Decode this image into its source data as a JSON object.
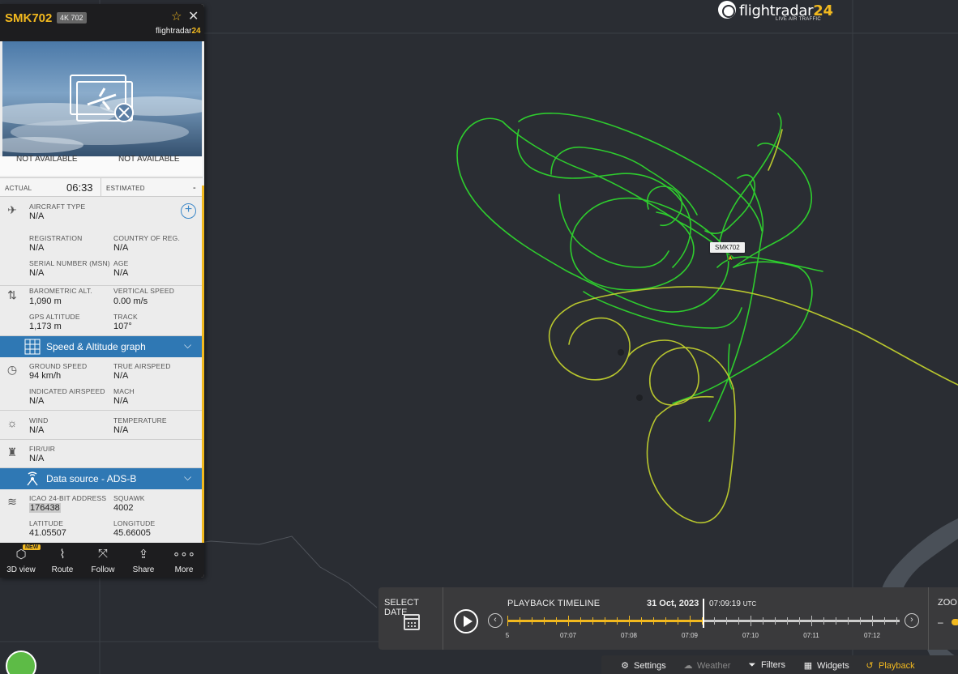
{
  "header": {
    "callsign": "SMK702",
    "registration_badge": "4K 702",
    "brand_prefix": "flightradar",
    "brand_suffix": "24"
  },
  "logo": {
    "name_prefix": "flightradar",
    "name_suffix": "24",
    "tagline": "LIVE AIR TRAFFIC"
  },
  "map": {
    "flight_label": "SMK702",
    "track_colors": {
      "high": "#2ecc2e",
      "low": "#b8c62e"
    }
  },
  "times": {
    "not_available_left": "NOT AVAILABLE",
    "not_available_right": "NOT AVAILABLE",
    "actual_label": "ACTUAL",
    "actual_value": "06:33",
    "estimated_label": "ESTIMATED",
    "estimated_value": "-"
  },
  "aircraft": {
    "type_label": "AIRCRAFT TYPE",
    "type_value": "N/A",
    "registration_label": "REGISTRATION",
    "registration_value": "N/A",
    "country_label": "COUNTRY OF REG.",
    "country_value": "N/A",
    "serial_label": "SERIAL NUMBER (MSN)",
    "serial_value": "N/A",
    "age_label": "AGE",
    "age_value": "N/A"
  },
  "altitude": {
    "baro_label": "BAROMETRIC ALT.",
    "baro_value": "1,090 m",
    "vs_label": "VERTICAL SPEED",
    "vs_value": "0.00 m/s",
    "gps_label": "GPS ALTITUDE",
    "gps_value": "1,173 m",
    "track_label": "TRACK",
    "track_value": "107°"
  },
  "speed_graph": {
    "label": "Speed & Altitude graph"
  },
  "speed": {
    "ground_label": "GROUND SPEED",
    "ground_value": "94 km/h",
    "true_label": "TRUE AIRSPEED",
    "true_value": "N/A",
    "indicated_label": "INDICATED AIRSPEED",
    "indicated_value": "N/A",
    "mach_label": "MACH",
    "mach_value": "N/A"
  },
  "weather": {
    "wind_label": "WIND",
    "wind_value": "N/A",
    "temp_label": "TEMPERATURE",
    "temp_value": "N/A"
  },
  "fir": {
    "label": "FIR/UIR",
    "value": "N/A"
  },
  "data_source": {
    "label": "Data source - ADS-B"
  },
  "adsb": {
    "icao_label": "ICAO 24-BIT ADDRESS",
    "icao_value": "176438",
    "squawk_label": "SQUAWK",
    "squawk_value": "4002",
    "lat_label": "LATITUDE",
    "lat_value": "41.05507",
    "lon_label": "LONGITUDE",
    "lon_value": "45.66005"
  },
  "actions": {
    "new_badge": "NEW",
    "view3d": "3D view",
    "route": "Route",
    "follow": "Follow",
    "share": "Share",
    "more": "More"
  },
  "playback": {
    "select_date": "SELECT DATE",
    "title": "PLAYBACK TIMELINE",
    "date": "31 Oct, 2023",
    "time": "07:09:19",
    "tz": "UTC",
    "progress": 0.5,
    "tick_labels": [
      "5",
      "07:07",
      "07:08",
      "07:09",
      "07:10",
      "07:11",
      "07:12"
    ],
    "zoom_label": "ZOO",
    "zoom_minus": "–"
  },
  "bottombar": {
    "settings": "Settings",
    "weather": "Weather",
    "filters": "Filters",
    "widgets": "Widgets",
    "playback": "Playback"
  }
}
